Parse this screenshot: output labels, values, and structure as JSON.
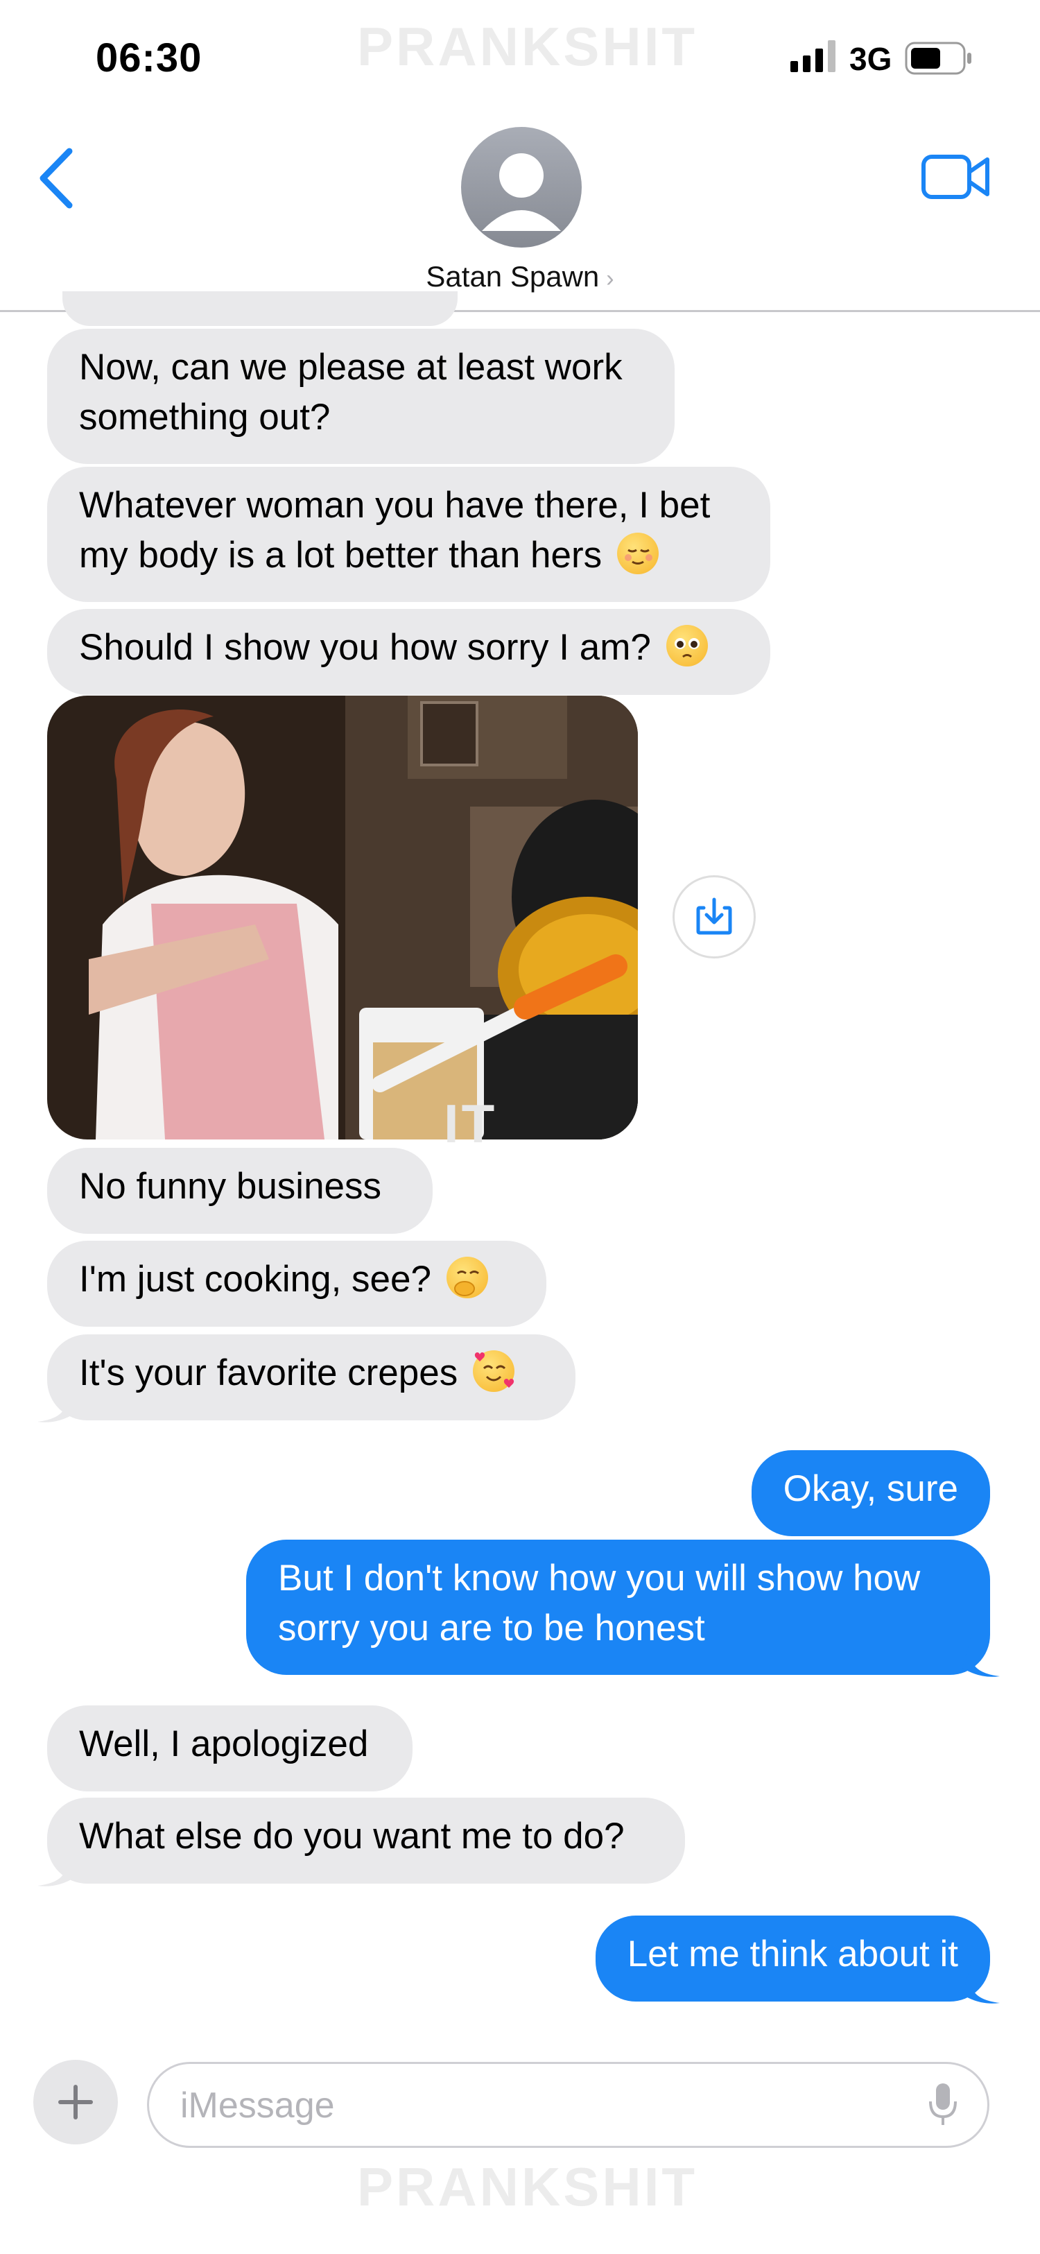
{
  "status_bar": {
    "time": "06:30",
    "network": "3G"
  },
  "watermark": "PRANKSHIT",
  "header": {
    "contact_name": "Satan Spawn"
  },
  "messages": [
    {
      "from": "them",
      "lines": [
        "Now, can we please at least work",
        "something out?"
      ]
    },
    {
      "from": "them",
      "lines": [
        "Whatever woman you have there, I bet",
        "my body is a lot better than hers"
      ],
      "emoji": "relieved-face"
    },
    {
      "from": "them",
      "lines": [
        "Should I show you how sorry I am?"
      ],
      "emoji": "pleading-face"
    },
    {
      "from": "them",
      "type": "photo",
      "description_icon": "selfie-cooking-photo"
    },
    {
      "from": "them",
      "lines": [
        "No funny business"
      ]
    },
    {
      "from": "them",
      "lines": [
        "I'm just cooking, see?"
      ],
      "emoji": "face-with-hand-over-mouth"
    },
    {
      "from": "them",
      "lines": [
        "It's your favorite crepes"
      ],
      "emoji": "smiling-face-with-hearts"
    },
    {
      "from": "me",
      "lines": [
        "Okay, sure"
      ]
    },
    {
      "from": "me",
      "lines": [
        "But I don't know how you will show how",
        "sorry you are to be honest"
      ]
    },
    {
      "from": "them",
      "lines": [
        "Well, I apologized"
      ]
    },
    {
      "from": "them",
      "lines": [
        "What else do you want me to do?"
      ]
    },
    {
      "from": "me",
      "lines": [
        "Let me think about it"
      ]
    }
  ],
  "composer": {
    "placeholder": "iMessage"
  },
  "colors": {
    "accent": "#1a85f5",
    "incoming_bubble": "#e9e9eb"
  }
}
